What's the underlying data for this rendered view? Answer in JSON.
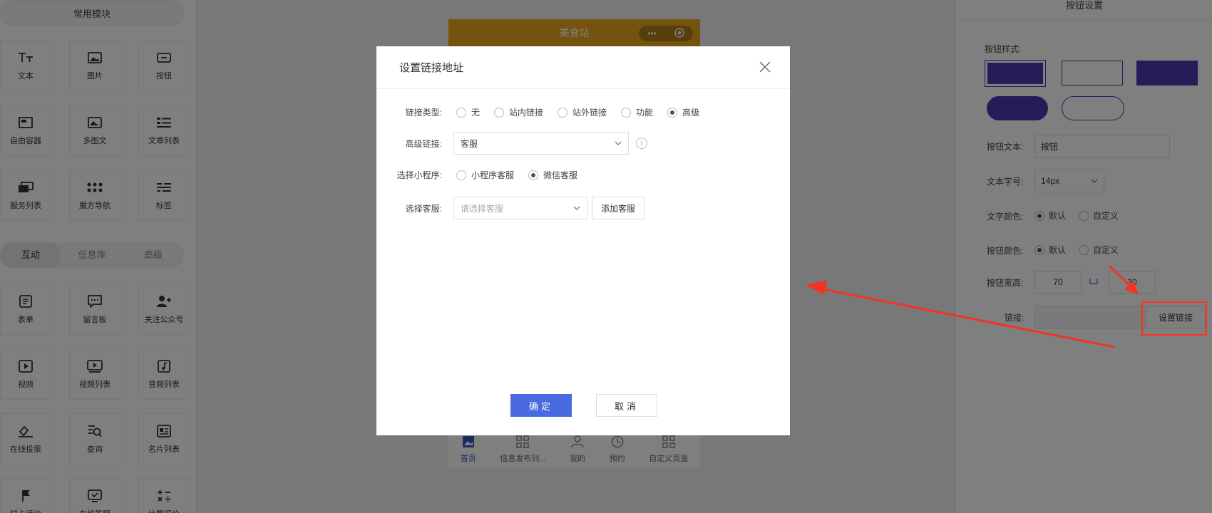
{
  "left_panel": {
    "section_title": "常用模块",
    "common_items": [
      {
        "label": "文本",
        "icon": "text-icon"
      },
      {
        "label": "图片",
        "icon": "image-icon"
      },
      {
        "label": "按钮",
        "icon": "button-icon"
      },
      {
        "label": "自由容器",
        "icon": "container-icon"
      },
      {
        "label": "多图文",
        "icon": "multi-image-text-icon"
      },
      {
        "label": "文章列表",
        "icon": "article-list-icon"
      },
      {
        "label": "服务列表",
        "icon": "service-list-icon"
      },
      {
        "label": "魔方导航",
        "icon": "grid-nav-icon"
      },
      {
        "label": "标签",
        "icon": "tag-icon"
      }
    ],
    "tabs": [
      "互动",
      "信息库",
      "高级"
    ],
    "interactive_items": [
      {
        "label": "表单",
        "icon": "form-icon"
      },
      {
        "label": "留言板",
        "icon": "message-board-icon"
      },
      {
        "label": "关注公众号",
        "icon": "follow-account-icon"
      },
      {
        "label": "视频",
        "icon": "video-icon"
      },
      {
        "label": "视频列表",
        "icon": "video-list-icon"
      },
      {
        "label": "音频列表",
        "icon": "audio-list-icon"
      },
      {
        "label": "在线投票",
        "icon": "vote-icon"
      },
      {
        "label": "查询",
        "icon": "query-icon"
      },
      {
        "label": "名片列表",
        "icon": "card-list-icon"
      },
      {
        "label": "打卡活动",
        "icon": "check-in-icon"
      },
      {
        "label": "在线答题",
        "icon": "quiz-icon"
      },
      {
        "label": "计算报价",
        "icon": "calculator-icon"
      }
    ]
  },
  "phone": {
    "title": "美食站",
    "capsule_dots": "•••",
    "tabbar": [
      {
        "label": "首页",
        "icon": "home-icon"
      },
      {
        "label": "信息发布列...",
        "icon": "grid-icon"
      },
      {
        "label": "我的",
        "icon": "user-icon"
      },
      {
        "label": "预约",
        "icon": "clock-icon"
      },
      {
        "label": "自定义页面",
        "icon": "grid-icon"
      }
    ]
  },
  "right_panel": {
    "title": "按钮设置",
    "style_label": "按钮样式:",
    "text_label": "按钮文本:",
    "text_value": "按钮",
    "font_size_label": "文本字号:",
    "font_size_value": "14px",
    "text_color_label": "文字颜色:",
    "button_color_label": "按钮颜色:",
    "color_options": [
      "默认",
      "自定义"
    ],
    "size_label": "按钮宽高:",
    "width_value": "70",
    "height_value": "30",
    "link_label": "链接:",
    "set_link_button": "设置链接",
    "accent_color": "#4b3bb0"
  },
  "modal": {
    "title": "设置链接地址",
    "link_type_label": "链接类型:",
    "link_types": [
      "无",
      "站内链接",
      "站外链接",
      "功能",
      "高级"
    ],
    "link_type_selected": 4,
    "advanced_link_label": "高级链接:",
    "advanced_link_value": "客服",
    "info_icon_text": "i",
    "miniprogram_label": "选择小程序:",
    "miniprogram_options": [
      "小程序客服",
      "微信客服"
    ],
    "miniprogram_selected": 1,
    "service_label": "选择客服:",
    "service_placeholder": "请选择客服",
    "add_service_button": "添加客服",
    "confirm_button": "确定",
    "cancel_button": "取消",
    "primary_color": "#4a6ae0"
  },
  "annotation": {
    "color": "#f53322"
  }
}
